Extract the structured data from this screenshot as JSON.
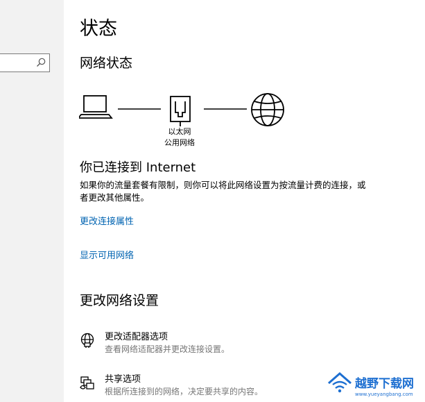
{
  "sidebar": {
    "search": {
      "value": "",
      "placeholder": ""
    }
  },
  "main": {
    "title": "状态",
    "network_status": {
      "heading": "网络状态",
      "adapter_name": "以太网",
      "network_type": "公用网络"
    },
    "connected": {
      "heading": "你已连接到 Internet",
      "description": "如果你的流量套餐有限制，则你可以将此网络设置为按流量计费的连接，或者更改其他属性。"
    },
    "links": {
      "change_properties": "更改连接属性",
      "show_networks": "显示可用网络"
    },
    "change_settings": {
      "heading": "更改网络设置",
      "options": [
        {
          "title": "更改适配器选项",
          "description": "查看网络适配器并更改连接设置。",
          "icon": "adapter-globe-icon"
        },
        {
          "title": "共享选项",
          "description": "根据所连接到的网络，决定要共享的内容。",
          "icon": "sharing-icon"
        }
      ]
    }
  },
  "watermark": {
    "text": "越野下载网",
    "url": "www.yueyangbang.com",
    "color": "#1d6fd1"
  }
}
